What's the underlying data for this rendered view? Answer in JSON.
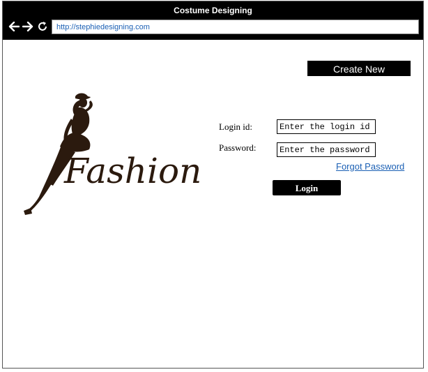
{
  "window": {
    "title": "Costume Designing"
  },
  "browser": {
    "url": "http://stephiedesigning.com",
    "icons": [
      "back-arrow-icon",
      "forward-arrow-icon",
      "reload-icon"
    ]
  },
  "header": {
    "create_new_label": "Create New"
  },
  "logo": {
    "text": "Fashion"
  },
  "login": {
    "login_id_label": "Login id:",
    "login_id_placeholder": "Enter the login id",
    "password_label": "Password:",
    "password_placeholder": "Enter the password",
    "forgot_label": "Forgot Password",
    "login_label": "Login"
  },
  "colors": {
    "titlebar": "#000000",
    "link": "#1a5fb4",
    "logo": "#2b1a0e"
  }
}
